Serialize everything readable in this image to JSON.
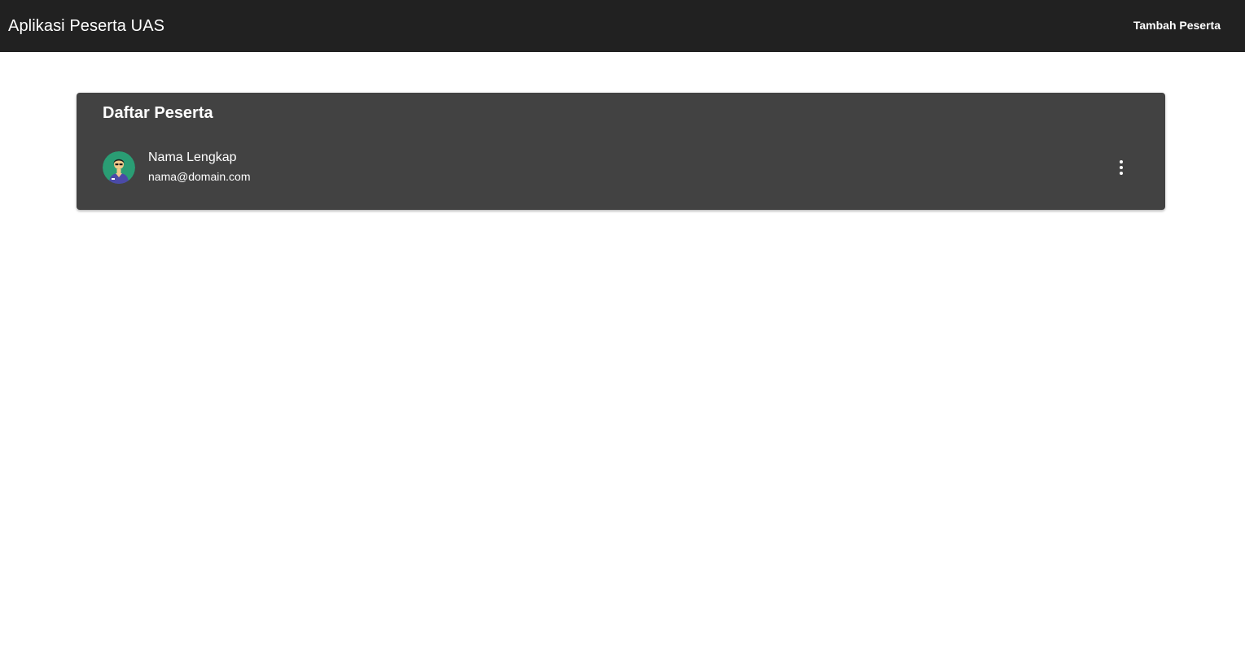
{
  "app_bar": {
    "title": "Aplikasi Peserta UAS",
    "action_label": "Tambah Peserta"
  },
  "card": {
    "title": "Daftar Peserta",
    "items": [
      {
        "name": "Nama Lengkap",
        "email": "nama@domain.com",
        "avatar_icon": "user-avatar-icon",
        "menu_icon": "more-vertical-icon"
      }
    ]
  },
  "colors": {
    "app_bar_bg": "#212121",
    "card_bg": "#424242",
    "avatar_bg": "#2a9d74"
  }
}
